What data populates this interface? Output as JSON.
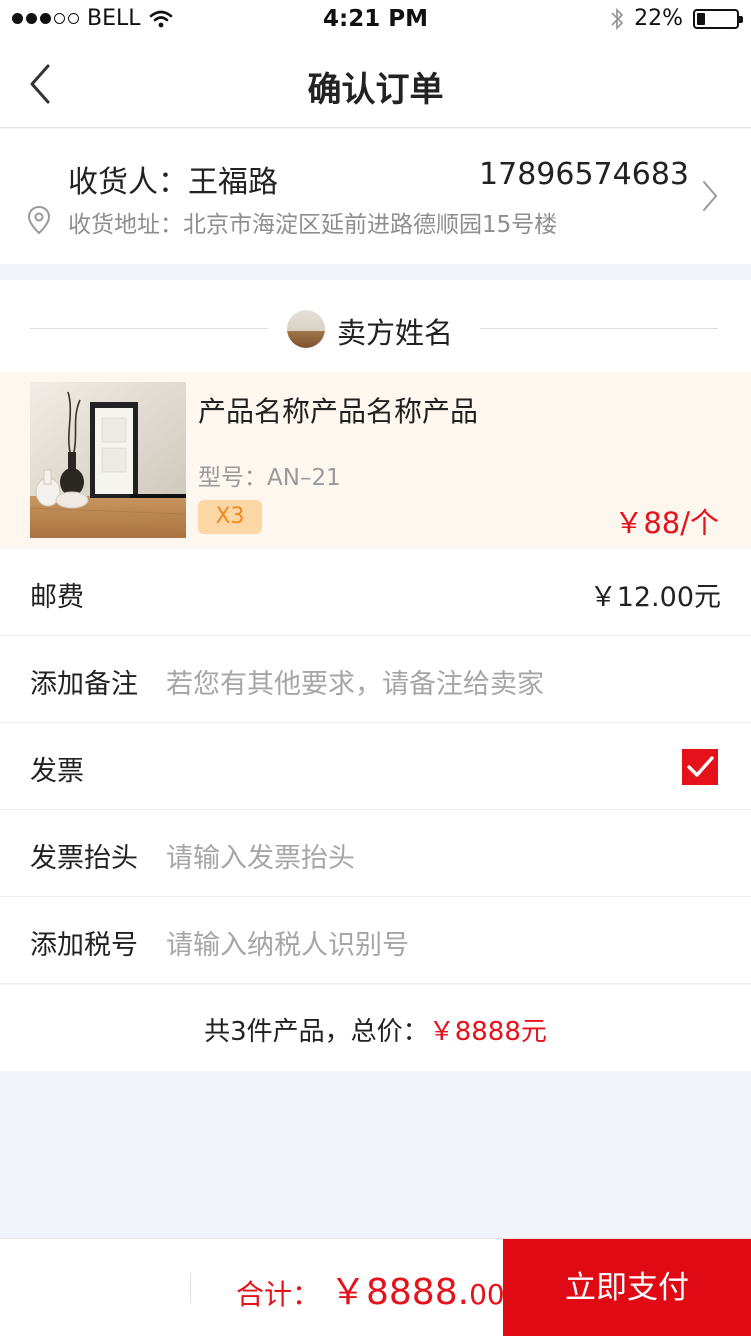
{
  "status_bar": {
    "carrier": "BELL",
    "time": "4:21 PM",
    "battery_text": "22%",
    "battery_level": 0.22,
    "signal_bars_filled": 3,
    "signal_bars_total": 5
  },
  "nav": {
    "title": "确认订单",
    "back_icon": "chevron-left-icon"
  },
  "address": {
    "receiver": "收货人：王福路",
    "phone": "17896574683",
    "address_text": "收货地址：北京市海淀区延前进路德顺园15号楼",
    "location_icon": "location-pin-icon",
    "chevron_icon": "chevron-right-icon"
  },
  "seller": {
    "name": "卖方姓名"
  },
  "product": {
    "name": "产品名称产品名称产品",
    "model": "型号：AN–21",
    "quantity": "X3",
    "price": "￥88/个"
  },
  "shipping": {
    "label": "邮费",
    "value": "￥12.00元"
  },
  "remark": {
    "label": "添加备注",
    "placeholder": "若您有其他要求，请备注给卖家"
  },
  "invoice": {
    "label": "发票",
    "checked": true
  },
  "invoice_title": {
    "label": "发票抬头",
    "placeholder": "请输入发票抬头"
  },
  "tax_number": {
    "label": "添加税号",
    "placeholder": "请输入纳税人识别号"
  },
  "summary": {
    "text": "共3件产品，总价：",
    "total": "￥8888元"
  },
  "bottom_bar": {
    "total_label": "合计：",
    "total_main": "￥8888.",
    "total_cents": "00",
    "pay_label": "立即支付"
  },
  "colors": {
    "accent_red": "#e5121b",
    "pay_button": "#e00a15",
    "product_bg": "#fdf7ef",
    "badge_bg": "#fcd7a6",
    "badge_text": "#f08a1a",
    "page_bg": "#f1f4fb"
  }
}
